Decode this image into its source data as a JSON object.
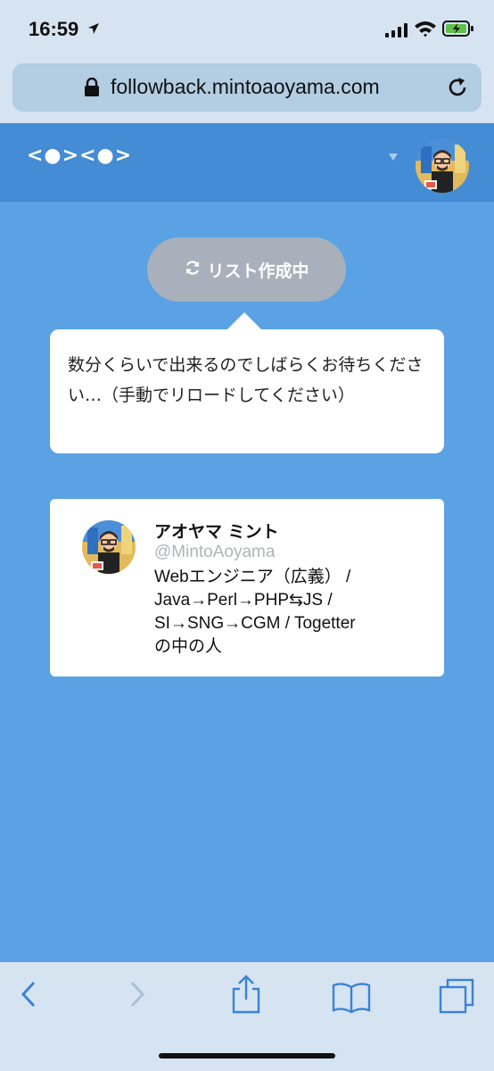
{
  "status_bar": {
    "time": "16:59"
  },
  "browser": {
    "url": "followback.mintoaoyama.com"
  },
  "header": {
    "logo": "<●><●>"
  },
  "status_pill": {
    "label": "リスト作成中"
  },
  "notice": {
    "text": "数分くらいで出来るのでしばらくお待ちください…（手動でリロードしてください）"
  },
  "profile": {
    "name": "アオヤマ ミント",
    "handle": "@MintoAoyama",
    "bio_lines": [
      "Webエンジニア（広義） /",
      "Java→Perl→PHP⇆JS /",
      "SI→SNG→CGM / Togetter",
      "の中の人"
    ]
  },
  "colors": {
    "page_bg": "#5ba2e4",
    "header_bg": "#448cd4",
    "pill_bg": "#a7b0bb",
    "toolbar_accent": "#3a82d8"
  }
}
